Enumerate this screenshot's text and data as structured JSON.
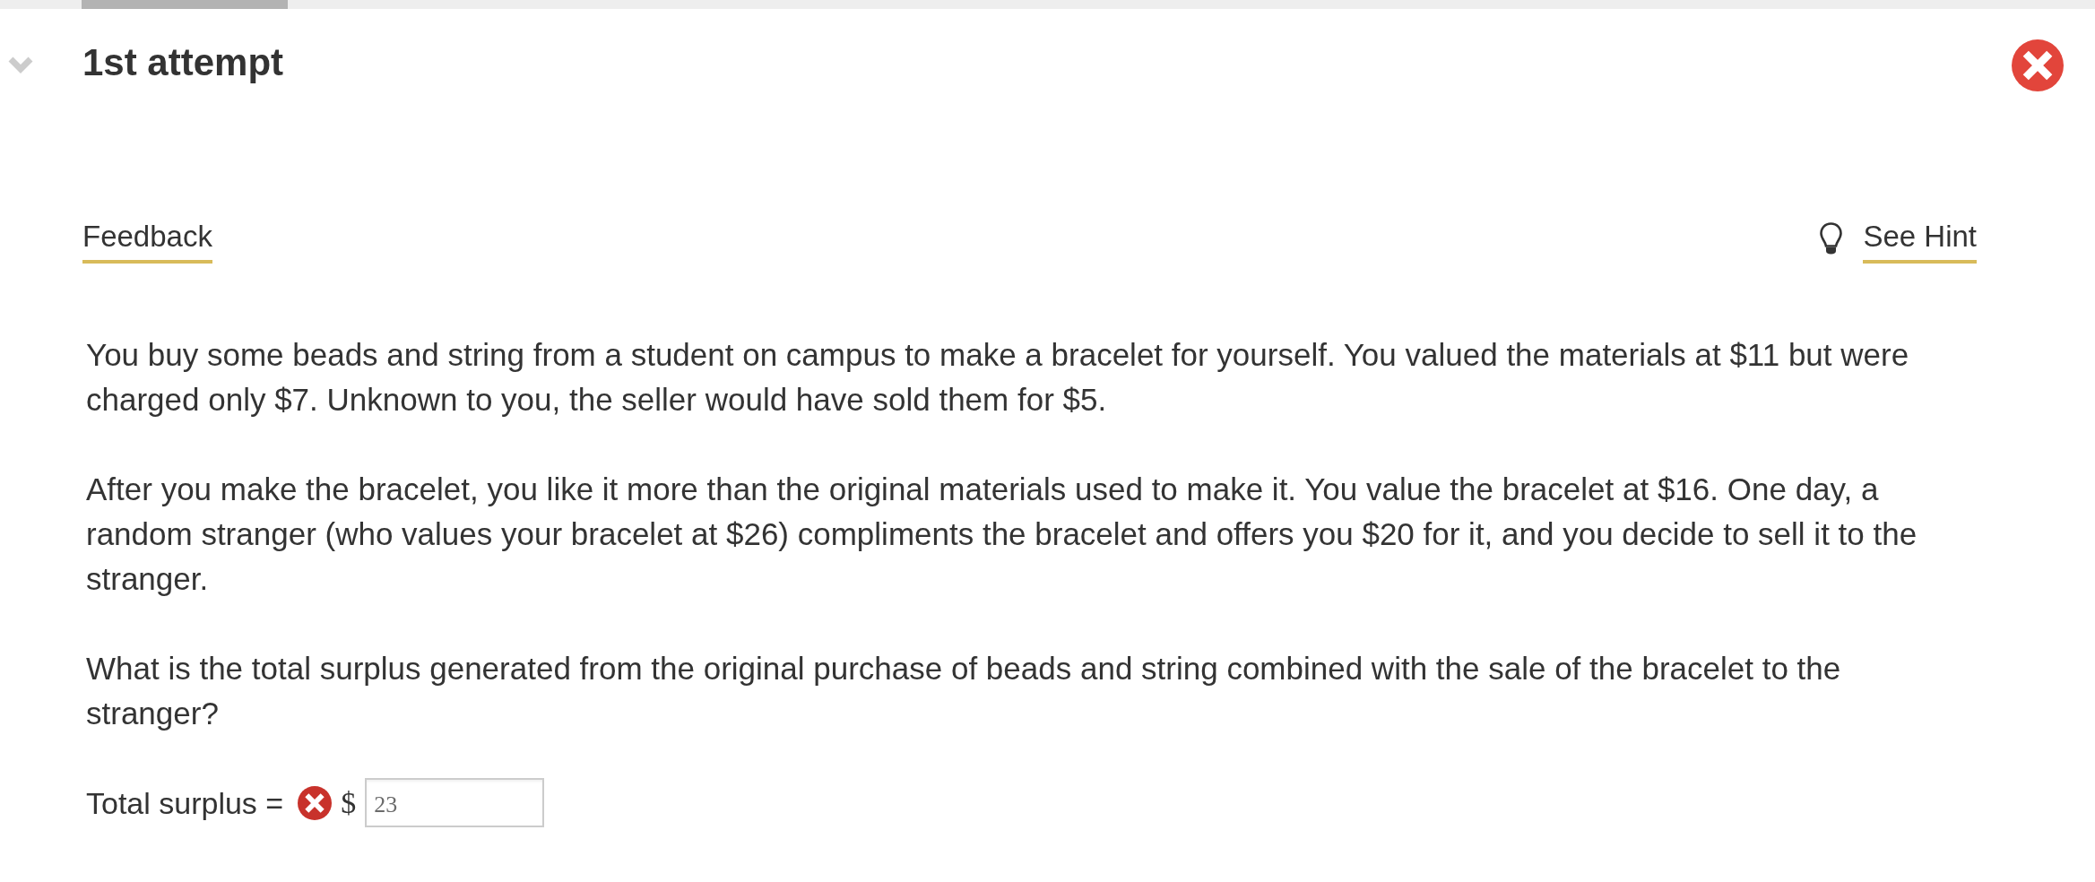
{
  "attempt": {
    "title": "1st attempt",
    "expanded": true,
    "correct": false
  },
  "toolbar": {
    "feedback": "Feedback",
    "hint": "See Hint"
  },
  "question": {
    "paragraphs": [
      "You buy some beads and string from a student on campus to make a bracelet for yourself. You valued the materials at $11 but were charged only $7. Unknown to you, the seller would have sold them for $5.",
      "After you make the bracelet, you like it more than the original materials used to make it. You value the bracelet at $16. One day, a random stranger (who values your bracelet at $26) compliments the bracelet and offers you $20 for it, and you decide to sell it to the stranger.",
      "What is the total surplus generated from the original purchase of beads and string combined with the sale of the bracelet to the stranger?"
    ]
  },
  "answer": {
    "label": "Total surplus =",
    "correct": false,
    "currency": "$",
    "value": "23"
  }
}
